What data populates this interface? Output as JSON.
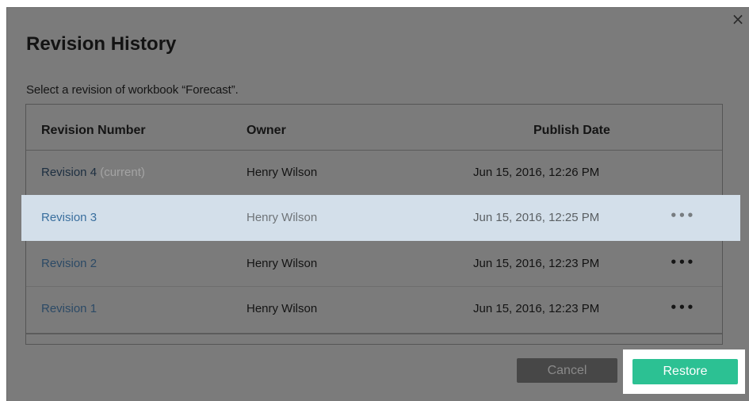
{
  "dialog": {
    "title": "Revision History",
    "subtitle": "Select a revision of workbook “Forecast”.",
    "close_icon": "×"
  },
  "table": {
    "headers": {
      "revision": "Revision Number",
      "owner": "Owner",
      "date": "Publish Date"
    },
    "rows": [
      {
        "revision": "Revision 4",
        "tag": "(current)",
        "owner": "Henry Wilson",
        "date": "Jun 15, 2016, 12:26 PM",
        "menu": ""
      },
      {
        "revision": "Revision 3",
        "tag": "",
        "owner": "Henry Wilson",
        "date": "Jun 15, 2016, 12:25 PM",
        "menu": "•••"
      },
      {
        "revision": "Revision 2",
        "tag": "",
        "owner": "Henry Wilson",
        "date": "Jun 15, 2016, 12:23 PM",
        "menu": "•••"
      },
      {
        "revision": "Revision 1",
        "tag": "",
        "owner": "Henry Wilson",
        "date": "Jun 15, 2016, 12:23 PM",
        "menu": "•••"
      }
    ],
    "selected_index": 1
  },
  "buttons": {
    "cancel": "Cancel",
    "restore": "Restore"
  },
  "colors": {
    "overlay": "#7b7b7b",
    "selected_row": "#d3dfea",
    "link": "#3a6f9e",
    "restore": "#2cc193",
    "cancel": "#474747"
  }
}
